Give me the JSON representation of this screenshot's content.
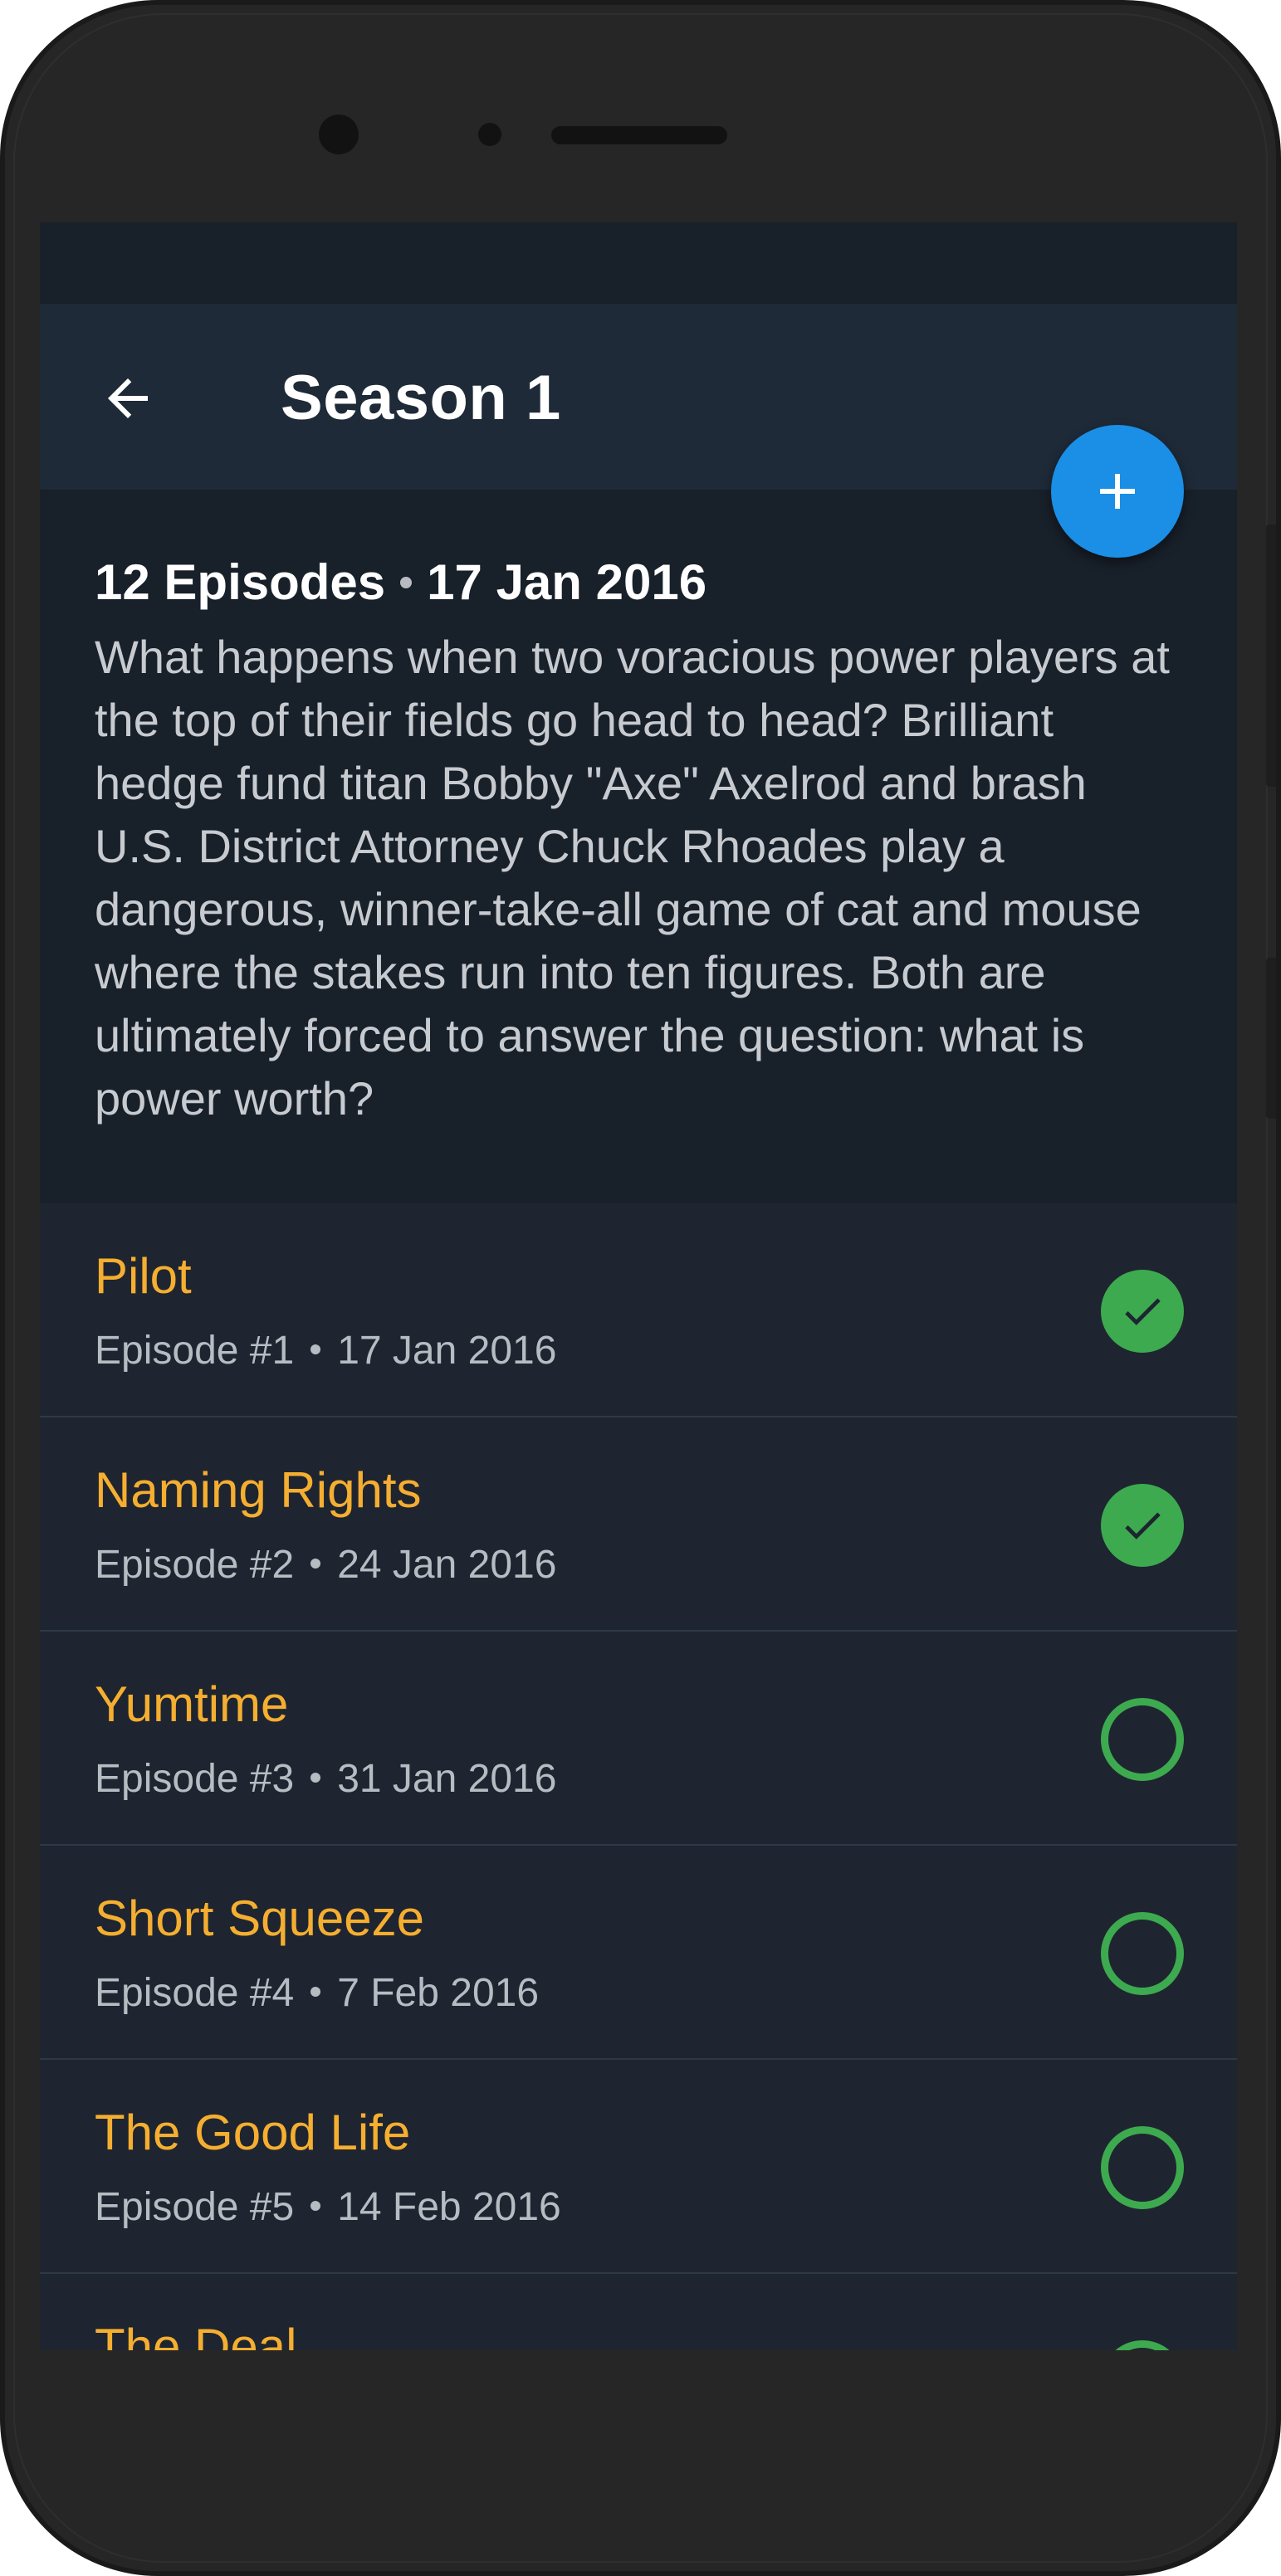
{
  "app_bar": {
    "title": "Season 1",
    "back_icon": "arrow-back-icon",
    "add_icon": "plus-icon"
  },
  "summary": {
    "episode_count": "12 Episodes",
    "air_date": "17 Jan 2016",
    "description": "What happens when two voracious power players at the top of their fields go head to head? Brilliant hedge fund titan Bobby \"Axe\" Axelrod and brash U.S. District Attorney Chuck Rhoades play a dangerous, winner-take-all game of cat and mouse where the stakes run into ten figures. Both are ultimately forced to answer the question: what is power worth?"
  },
  "episodes": [
    {
      "title": "Pilot",
      "number": "Episode #1",
      "date": "17 Jan 2016",
      "watched": true
    },
    {
      "title": "Naming Rights",
      "number": "Episode #2",
      "date": "24 Jan 2016",
      "watched": true
    },
    {
      "title": "Yumtime",
      "number": "Episode #3",
      "date": "31 Jan 2016",
      "watched": false
    },
    {
      "title": "Short Squeeze",
      "number": "Episode #4",
      "date": "7 Feb 2016",
      "watched": false
    },
    {
      "title": "The Good Life",
      "number": "Episode #5",
      "date": "14 Feb 2016",
      "watched": false
    },
    {
      "title": "The Deal",
      "number": "",
      "date": "",
      "watched": false
    }
  ],
  "colors": {
    "accent": "#1b8ee6",
    "episode_title": "#f5ae30",
    "watched": "#3daa4f",
    "app_bar": "#1e2a38",
    "background": "#18202a"
  }
}
